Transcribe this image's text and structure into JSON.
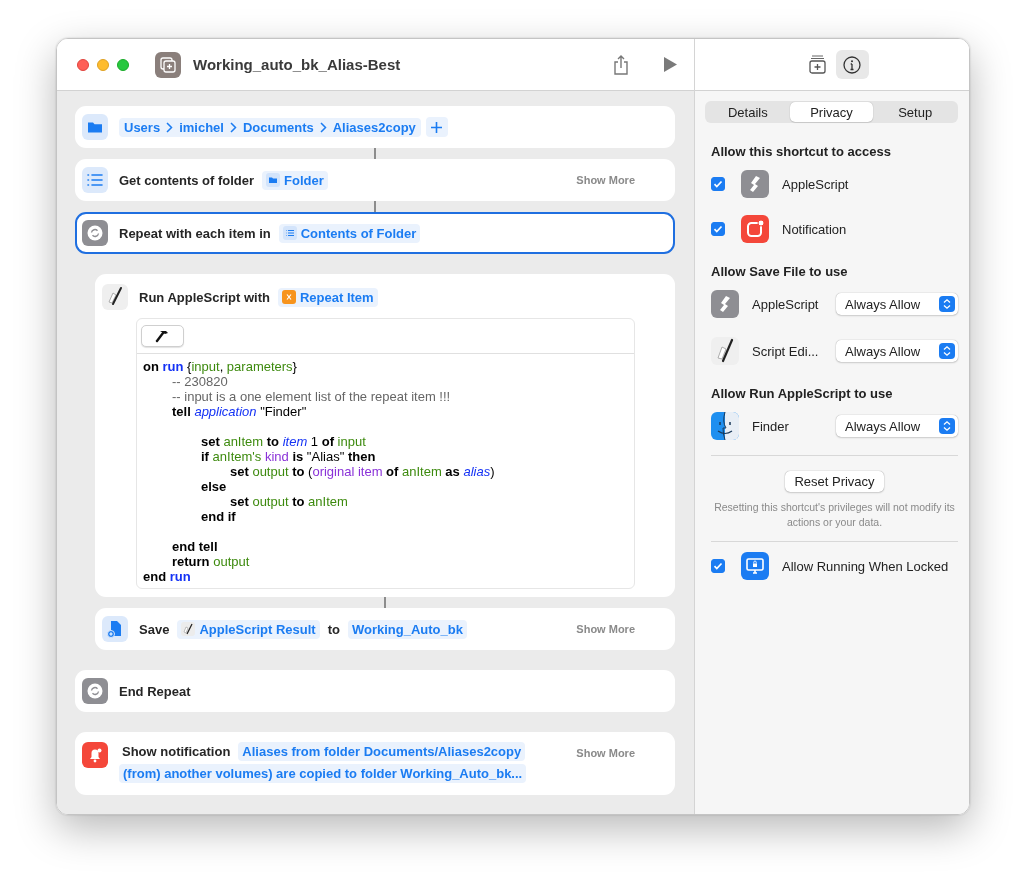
{
  "window": {
    "title": "Working_auto_bk_Alias-Best"
  },
  "actions": [
    {
      "kind": "path",
      "indented": false,
      "selected": false,
      "connector_above": false,
      "segments": [
        "Users",
        "imichel",
        "Documents",
        "Aliases2copy"
      ]
    },
    {
      "kind": "get_contents",
      "indented": false,
      "selected": false,
      "connector_above": true,
      "parts": [
        {
          "kind": "text",
          "text": "Get contents of folder"
        },
        {
          "kind": "folder_token",
          "text": "Folder"
        }
      ],
      "show_more": "Show More"
    },
    {
      "kind": "repeat",
      "indented": false,
      "selected": true,
      "connector_above": true,
      "parts": [
        {
          "kind": "text",
          "text": "Repeat with each item in"
        },
        {
          "kind": "list_token",
          "text": "Contents of Folder"
        }
      ]
    },
    {
      "kind": "script",
      "indented": true,
      "selected": false,
      "connector_above": false,
      "parts": [
        {
          "kind": "text",
          "text": "Run AppleScript with"
        },
        {
          "kind": "variable_token",
          "text": "Repeat Item"
        }
      ],
      "code": [
        {
          "kind": "code",
          "tokens": [
            {
              "text": "on ",
              "kind": "keyword"
            },
            {
              "text": "run",
              "kind": "handler"
            },
            {
              "text": " {",
              "kind": "plain"
            },
            {
              "text": "input",
              "kind": "variable"
            },
            {
              "text": ", ",
              "kind": "plain"
            },
            {
              "text": "parameters",
              "kind": "variable"
            },
            {
              "text": "}",
              "kind": "plain"
            }
          ]
        },
        {
          "kind": "code",
          "tokens": [
            {
              "text": "\t-- 230820",
              "kind": "comment"
            }
          ]
        },
        {
          "kind": "code",
          "tokens": [
            {
              "text": "\t-- input is a one element list of the repeat item !!!",
              "kind": "comment"
            }
          ]
        },
        {
          "kind": "code",
          "tokens": [
            {
              "text": "\ttell ",
              "kind": "keyword"
            },
            {
              "text": "application",
              "kind": "class"
            },
            {
              "text": " \"Finder\"",
              "kind": "plain"
            }
          ]
        },
        {
          "kind": "blank"
        },
        {
          "kind": "code",
          "tokens": [
            {
              "text": "\t\tset ",
              "kind": "keyword"
            },
            {
              "text": "anItem",
              "kind": "variable"
            },
            {
              "text": " to ",
              "kind": "keyword"
            },
            {
              "text": "item",
              "kind": "class"
            },
            {
              "text": " 1 ",
              "kind": "plain"
            },
            {
              "text": "of ",
              "kind": "keyword"
            },
            {
              "text": "input",
              "kind": "variable"
            }
          ]
        },
        {
          "kind": "code",
          "tokens": [
            {
              "text": "\t\tif ",
              "kind": "keyword"
            },
            {
              "text": "anItem's ",
              "kind": "variable"
            },
            {
              "text": "kind",
              "kind": "property"
            },
            {
              "text": " is ",
              "kind": "keyword"
            },
            {
              "text": "\"Alias\" ",
              "kind": "plain"
            },
            {
              "text": "then",
              "kind": "keyword"
            }
          ]
        },
        {
          "kind": "code",
          "tokens": [
            {
              "text": "\t\t\tset ",
              "kind": "keyword"
            },
            {
              "text": "output",
              "kind": "variable"
            },
            {
              "text": " to ",
              "kind": "keyword"
            },
            {
              "text": "(",
              "kind": "plain"
            },
            {
              "text": "original item",
              "kind": "property"
            },
            {
              "text": " of ",
              "kind": "keyword"
            },
            {
              "text": "anItem",
              "kind": "variable"
            },
            {
              "text": " as ",
              "kind": "keyword"
            },
            {
              "text": "alias",
              "kind": "class"
            },
            {
              "text": ")",
              "kind": "plain"
            }
          ]
        },
        {
          "kind": "code",
          "tokens": [
            {
              "text": "\t\telse",
              "kind": "keyword"
            }
          ]
        },
        {
          "kind": "code",
          "tokens": [
            {
              "text": "\t\t\tset ",
              "kind": "keyword"
            },
            {
              "text": "output",
              "kind": "variable"
            },
            {
              "text": " to ",
              "kind": "keyword"
            },
            {
              "text": "anItem",
              "kind": "variable"
            }
          ]
        },
        {
          "kind": "code",
          "tokens": [
            {
              "text": "\t\tend if",
              "kind": "keyword"
            }
          ]
        },
        {
          "kind": "blank"
        },
        {
          "kind": "code",
          "tokens": [
            {
              "text": "\tend tell",
              "kind": "keyword"
            }
          ]
        },
        {
          "kind": "code",
          "tokens": [
            {
              "text": "\treturn ",
              "kind": "keyword"
            },
            {
              "text": "output",
              "kind": "variable"
            }
          ]
        },
        {
          "kind": "code",
          "tokens": [
            {
              "text": "end ",
              "kind": "keyword"
            },
            {
              "text": "run",
              "kind": "handler"
            }
          ]
        }
      ]
    },
    {
      "kind": "save",
      "indented": true,
      "selected": false,
      "connector_above": true,
      "parts": [
        {
          "kind": "text",
          "text": "Save"
        },
        {
          "kind": "result_token",
          "text": "AppleScript Result"
        },
        {
          "kind": "text",
          "text": "to"
        },
        {
          "kind": "token",
          "text": "Working_Auto_bk"
        }
      ],
      "show_more": "Show More"
    },
    {
      "kind": "end_repeat",
      "indented": false,
      "selected": false,
      "connector_above": false,
      "parts": [
        {
          "kind": "text",
          "text": "End Repeat"
        }
      ]
    },
    {
      "kind": "notification",
      "indented": false,
      "selected": false,
      "connector_above": false,
      "parts": [
        {
          "kind": "text",
          "text": "Show notification"
        },
        {
          "kind": "token",
          "text": "Aliases from folder Documents/Aliases2copy"
        },
        {
          "kind": "token",
          "text": "(from) another volumes) are copied to folder Working_Auto_bk..."
        }
      ],
      "show_more": "Show More"
    }
  ],
  "inspector": {
    "toolbar": [
      {
        "selected": false
      },
      {
        "selected": true
      }
    ],
    "tabs": [
      {
        "label": "Details",
        "selected": false
      },
      {
        "label": "Privacy",
        "selected": true
      },
      {
        "label": "Setup",
        "selected": false
      }
    ],
    "sections": [
      {
        "heading": "Allow this shortcut to access",
        "items": [
          {
            "kind": "check",
            "checked": true,
            "label": "AppleScript"
          },
          {
            "kind": "check",
            "checked": true,
            "label": "Notification"
          }
        ]
      },
      {
        "heading": "Allow Save File to use",
        "items": [
          {
            "kind": "select",
            "label": "AppleScript",
            "value": "Always Allow"
          },
          {
            "kind": "select",
            "label": "Script Edi...",
            "value": "Always Allow"
          }
        ]
      },
      {
        "heading": "Allow Run AppleScript to use",
        "items": [
          {
            "kind": "select",
            "label": "Finder",
            "value": "Always Allow"
          }
        ]
      }
    ],
    "reset_button": "Reset Privacy",
    "reset_note": "Resetting this shortcut's privileges will not modify its actions or your data.",
    "lock_option": {
      "checked": true,
      "label": "Allow Running When Locked"
    }
  }
}
